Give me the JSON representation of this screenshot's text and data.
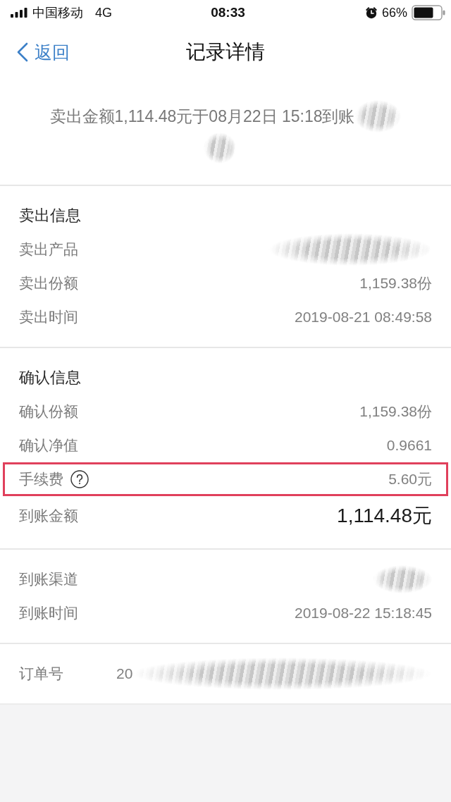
{
  "status_bar": {
    "carrier": "中国移动",
    "network": "4G",
    "time": "08:33",
    "battery": "66%"
  },
  "nav_bar": {
    "back_label": "返回",
    "title": "记录详情"
  },
  "summary": {
    "text": "卖出金额1,114.48元于08月22日 15:18到账"
  },
  "sections": [
    {
      "title": "卖出信息",
      "rows": [
        {
          "kind": "redacted",
          "label": "卖出产品",
          "help": false,
          "highlighted": false
        },
        {
          "kind": "text",
          "label": "卖出份额",
          "value": "1,159.38份",
          "help": false,
          "highlighted": false
        },
        {
          "kind": "text",
          "label": "卖出时间",
          "value": "2019-08-21 08:49:58",
          "help": false,
          "highlighted": false
        }
      ]
    },
    {
      "title": "确认信息",
      "rows": [
        {
          "kind": "text",
          "label": "确认份额",
          "value": "1,159.38份",
          "help": false,
          "highlighted": false
        },
        {
          "kind": "text",
          "label": "确认净值",
          "value": "0.9661",
          "help": false,
          "highlighted": false
        },
        {
          "kind": "text",
          "label": "手续费",
          "value": "5.60元",
          "help": true,
          "highlighted": true
        },
        {
          "kind": "amount",
          "label": "到账金额",
          "value": "1,114.48元",
          "help": false,
          "highlighted": false
        }
      ]
    },
    {
      "rows": [
        {
          "kind": "redacted",
          "label": "到账渠道",
          "help": false,
          "highlighted": false
        },
        {
          "kind": "text",
          "label": "到账时间",
          "value": "2019-08-22 15:18:45",
          "help": false,
          "highlighted": false
        }
      ]
    },
    {
      "rows": [
        {
          "kind": "order",
          "label": "订单号",
          "value": "20",
          "help": false,
          "highlighted": false
        }
      ]
    }
  ]
}
